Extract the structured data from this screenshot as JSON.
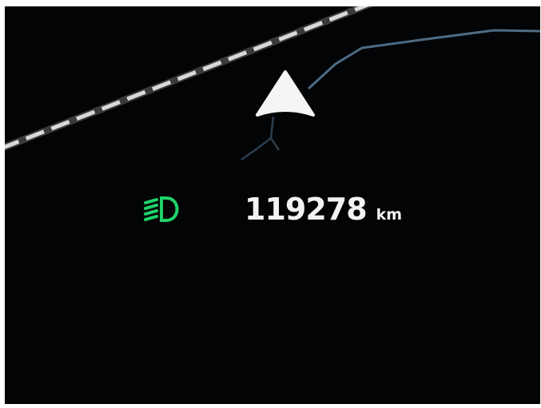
{
  "odometer": {
    "value": "119278",
    "unit": "km"
  },
  "indicators": {
    "headlight": {
      "icon": "low-beam-headlight-icon",
      "color": "#1fd36a",
      "active": true
    }
  },
  "navigation": {
    "arrow_icon": "navigation-arrow-icon",
    "route_color": "#5b7f9b",
    "road_color": "#d9d9d9"
  }
}
